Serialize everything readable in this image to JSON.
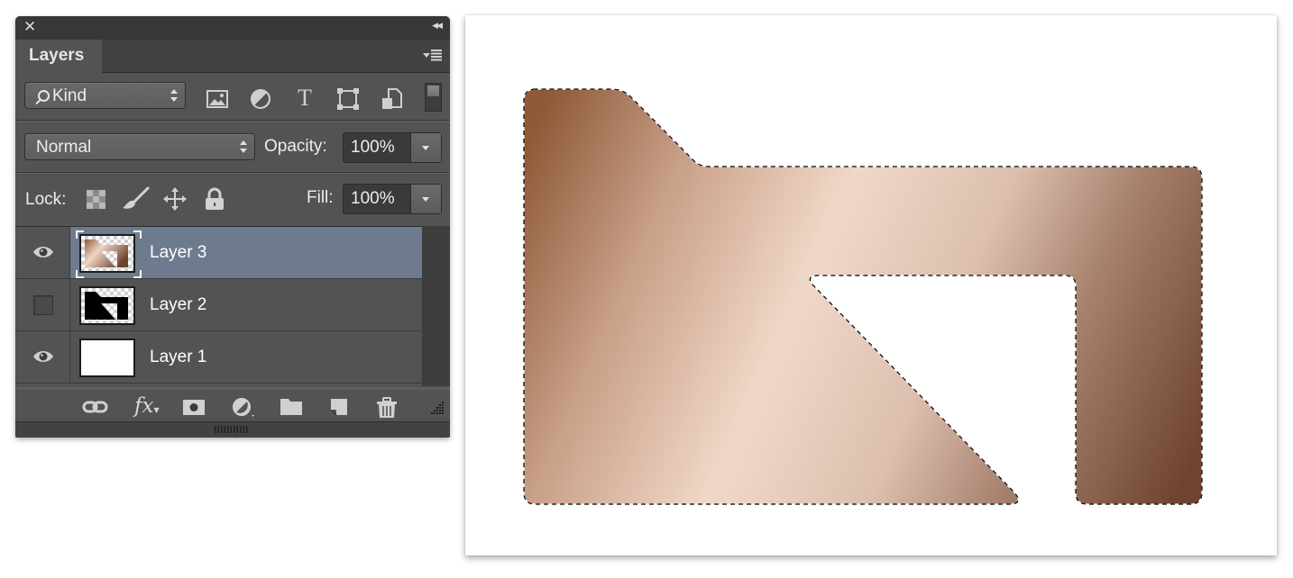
{
  "panel": {
    "title": "Layers",
    "close_icon": "close-icon",
    "collapse_icon": "collapse-double-arrow-icon",
    "menu_icon": "panel-menu-icon",
    "filter": {
      "kind_label": "Kind",
      "filter_icons": [
        "pixel-layer-filter-icon",
        "adjustment-layer-filter-icon",
        "type-layer-filter-icon",
        "shape-layer-filter-icon",
        "smart-object-filter-icon"
      ],
      "type_glyph": "T"
    },
    "blend_mode": "Normal",
    "opacity_label": "Opacity:",
    "opacity_value": "100%",
    "lock_label": "Lock:",
    "lock_icons": [
      "lock-transparent-pixels-icon",
      "lock-image-pixels-icon",
      "lock-position-icon",
      "lock-all-icon"
    ],
    "fill_label": "Fill:",
    "fill_value": "100%",
    "layers": [
      {
        "name": "Layer 3",
        "visible": true,
        "selected": true
      },
      {
        "name": "Layer 2",
        "visible": false,
        "selected": false
      },
      {
        "name": "Layer 1",
        "visible": true,
        "selected": false
      }
    ],
    "bottom_icons": [
      "link-layers-icon",
      "fx-icon",
      "add-mask-icon",
      "adjustment-layer-icon",
      "new-group-icon",
      "new-layer-icon",
      "delete-layer-icon"
    ],
    "fx_label": "fx"
  },
  "canvas": {
    "shape": "folder-shape-with-copper-gradient",
    "selection": "marching-ants",
    "gradient_colors": [
      "#8e5a38",
      "#f0d6c4",
      "#a8826e",
      "#6e4330"
    ]
  }
}
